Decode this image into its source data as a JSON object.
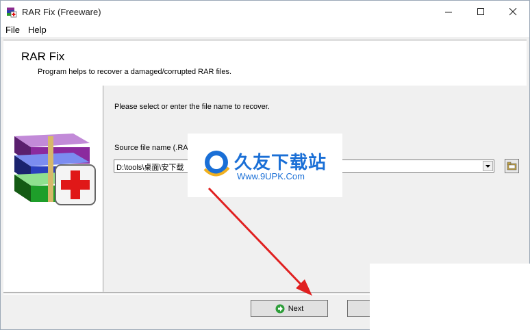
{
  "window": {
    "title": "RAR Fix (Freeware)"
  },
  "menu": {
    "file": "File",
    "help": "Help"
  },
  "header": {
    "title": "RAR Fix",
    "subtitle": "Program helps to recover a damaged/corrupted RAR files."
  },
  "main": {
    "instruction": "Please select or enter the file name to recover.",
    "source_label": "Source file name (.RAR",
    "source_value": "D:\\tools\\桌面\\安下载"
  },
  "buttons": {
    "next": "Next"
  },
  "watermark": {
    "cn": "久友下载站",
    "url": "Www.9UPK.Com"
  },
  "colors": {
    "accent_arrow": "#e02020",
    "watermark_blue": "#1a6fd6"
  }
}
